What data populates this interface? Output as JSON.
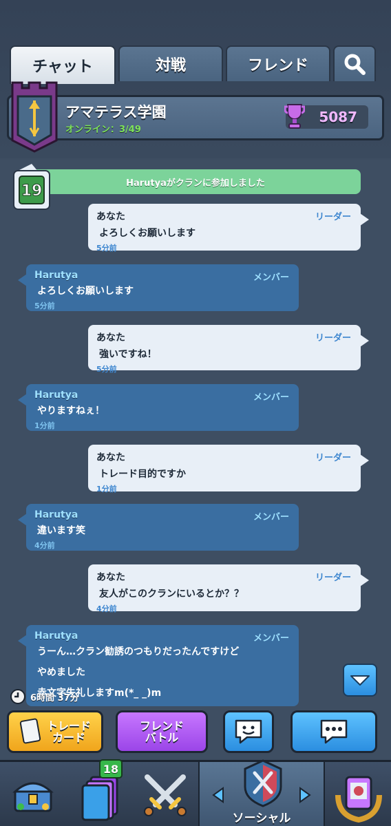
{
  "tabs": {
    "chat": "チャット",
    "battle": "対戦",
    "friends": "フレンド"
  },
  "clan": {
    "name": "アマテラス学園",
    "online": "オンライン：3/49",
    "trophies": "5087"
  },
  "system_message": "Harutyaがクランに参加しました",
  "level": "19",
  "messages": [
    {
      "sender": "あなた",
      "role": "リーダー",
      "text": "よろしくお願いします",
      "time": "5分前"
    },
    {
      "sender": "Harutya",
      "role": "メンバー",
      "text": "よろしくお願いします",
      "time": "5分前"
    },
    {
      "sender": "あなた",
      "role": "リーダー",
      "text": "強いですね！",
      "time": "5分前"
    },
    {
      "sender": "Harutya",
      "role": "メンバー",
      "text": "やりますねぇ！",
      "time": "1分前"
    },
    {
      "sender": "あなた",
      "role": "リーダー",
      "text": "トレード目的ですか",
      "time": "1分前"
    },
    {
      "sender": "Harutya",
      "role": "メンバー",
      "text": "違います笑",
      "time": "4分前"
    },
    {
      "sender": "あなた",
      "role": "リーダー",
      "text": "友人がこのクランにいるとか？？",
      "time": "4分前"
    },
    {
      "sender": "Harutya",
      "role": "メンバー",
      "lines": [
        "うーん…クラン勧誘のつもりだったんですけど",
        "やめました",
        "赤文字失礼しますm(*_ _)m"
      ]
    }
  ],
  "timer": "6時間 37分",
  "actions": {
    "trade": [
      "トレード",
      "カード"
    ],
    "friend_battle": [
      "フレンド",
      "バトル"
    ]
  },
  "nav": {
    "card_count": "18",
    "social_label": "ソーシャル"
  },
  "colors": {
    "system_green": "#7cd39a",
    "mine_bubble": "#e8eff7",
    "theirs_bubble": "#3a6ea1",
    "accent_blue": "#2b8ee0",
    "trade_yellow": "#f0a51c",
    "friend_purple": "#9b45e8"
  }
}
